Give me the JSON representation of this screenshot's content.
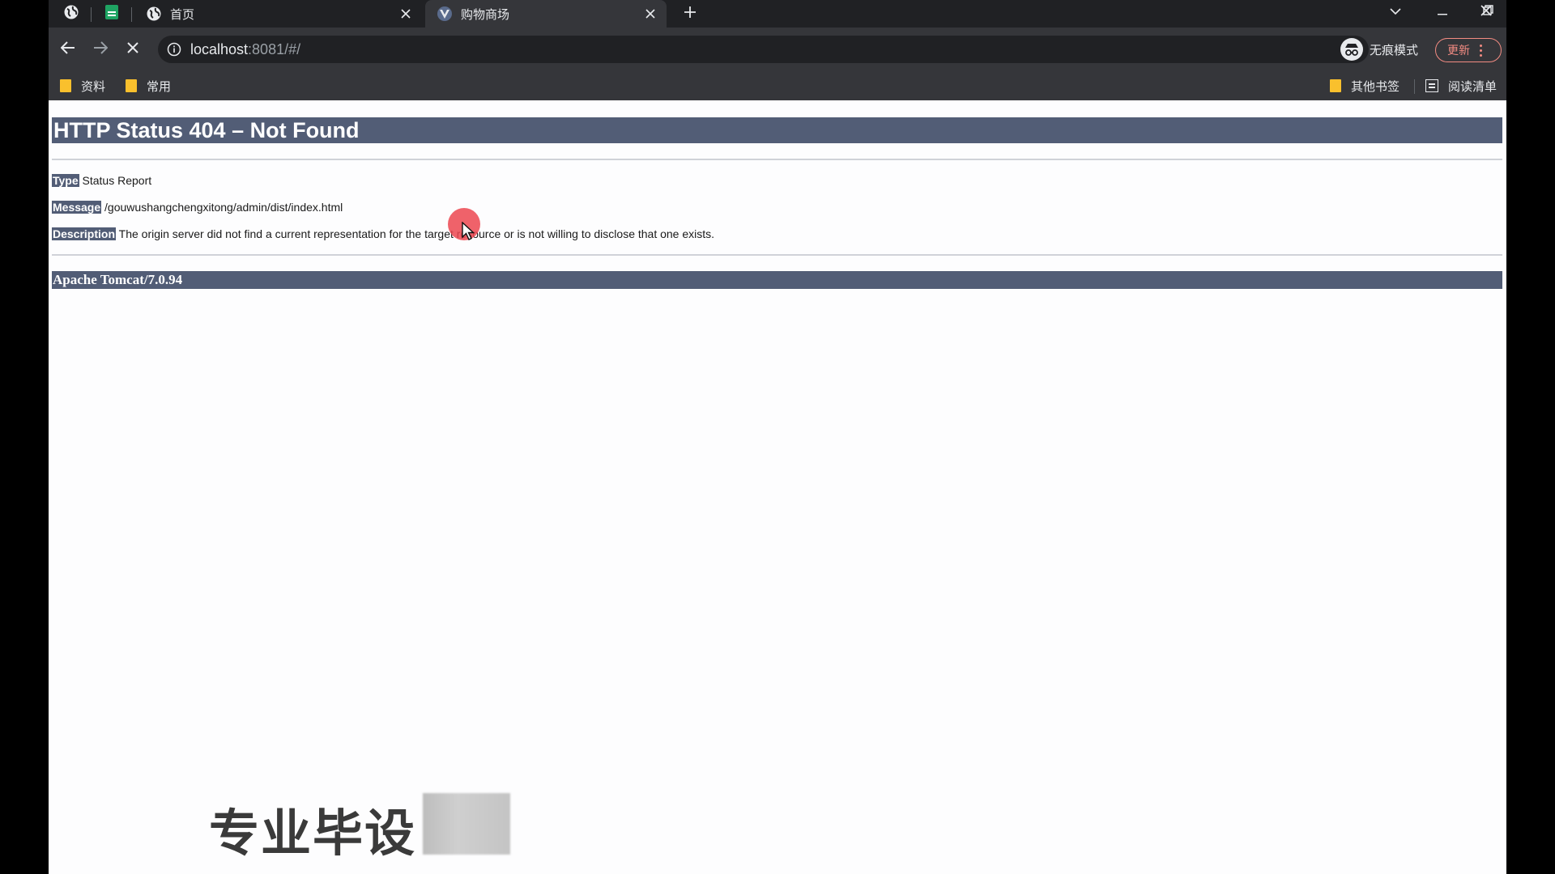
{
  "browser": {
    "tabs": [
      {
        "title": "首页",
        "favicon": "globe-icon",
        "active": false
      },
      {
        "title": "购物商场",
        "favicon": "vue-icon",
        "active": true
      }
    ],
    "pinned_tabs": [
      "globe-icon",
      "sheet-icon"
    ],
    "url_host": "localhost",
    "url_rest": ":8081/#/",
    "incognito_label": "无痕模式",
    "update_label": "更新",
    "loading": true
  },
  "bookmarks": {
    "items": [
      "资料",
      "常用"
    ],
    "other_label": "其他书签",
    "reading_list_label": "阅读清单"
  },
  "page": {
    "title": "HTTP Status 404 – Not Found",
    "type_key": "Type",
    "type_value": "Status Report",
    "message_key": "Message",
    "message_value": "/gouwushangchengxitong/admin/dist/index.html",
    "description_key": "Description",
    "description_value": "The origin server did not find a current representation for the target resource or is not willing to disclose that one exists.",
    "footer": "Apache Tomcat/7.0.94"
  },
  "overlay": {
    "watermark_text": "专业毕设"
  },
  "colors": {
    "tomcat_header": "#525d76",
    "browser_dark": "#202124",
    "browser_toolbar": "#35363a",
    "update_accent": "#f28b82",
    "cursor_highlight": "#ec4650"
  }
}
